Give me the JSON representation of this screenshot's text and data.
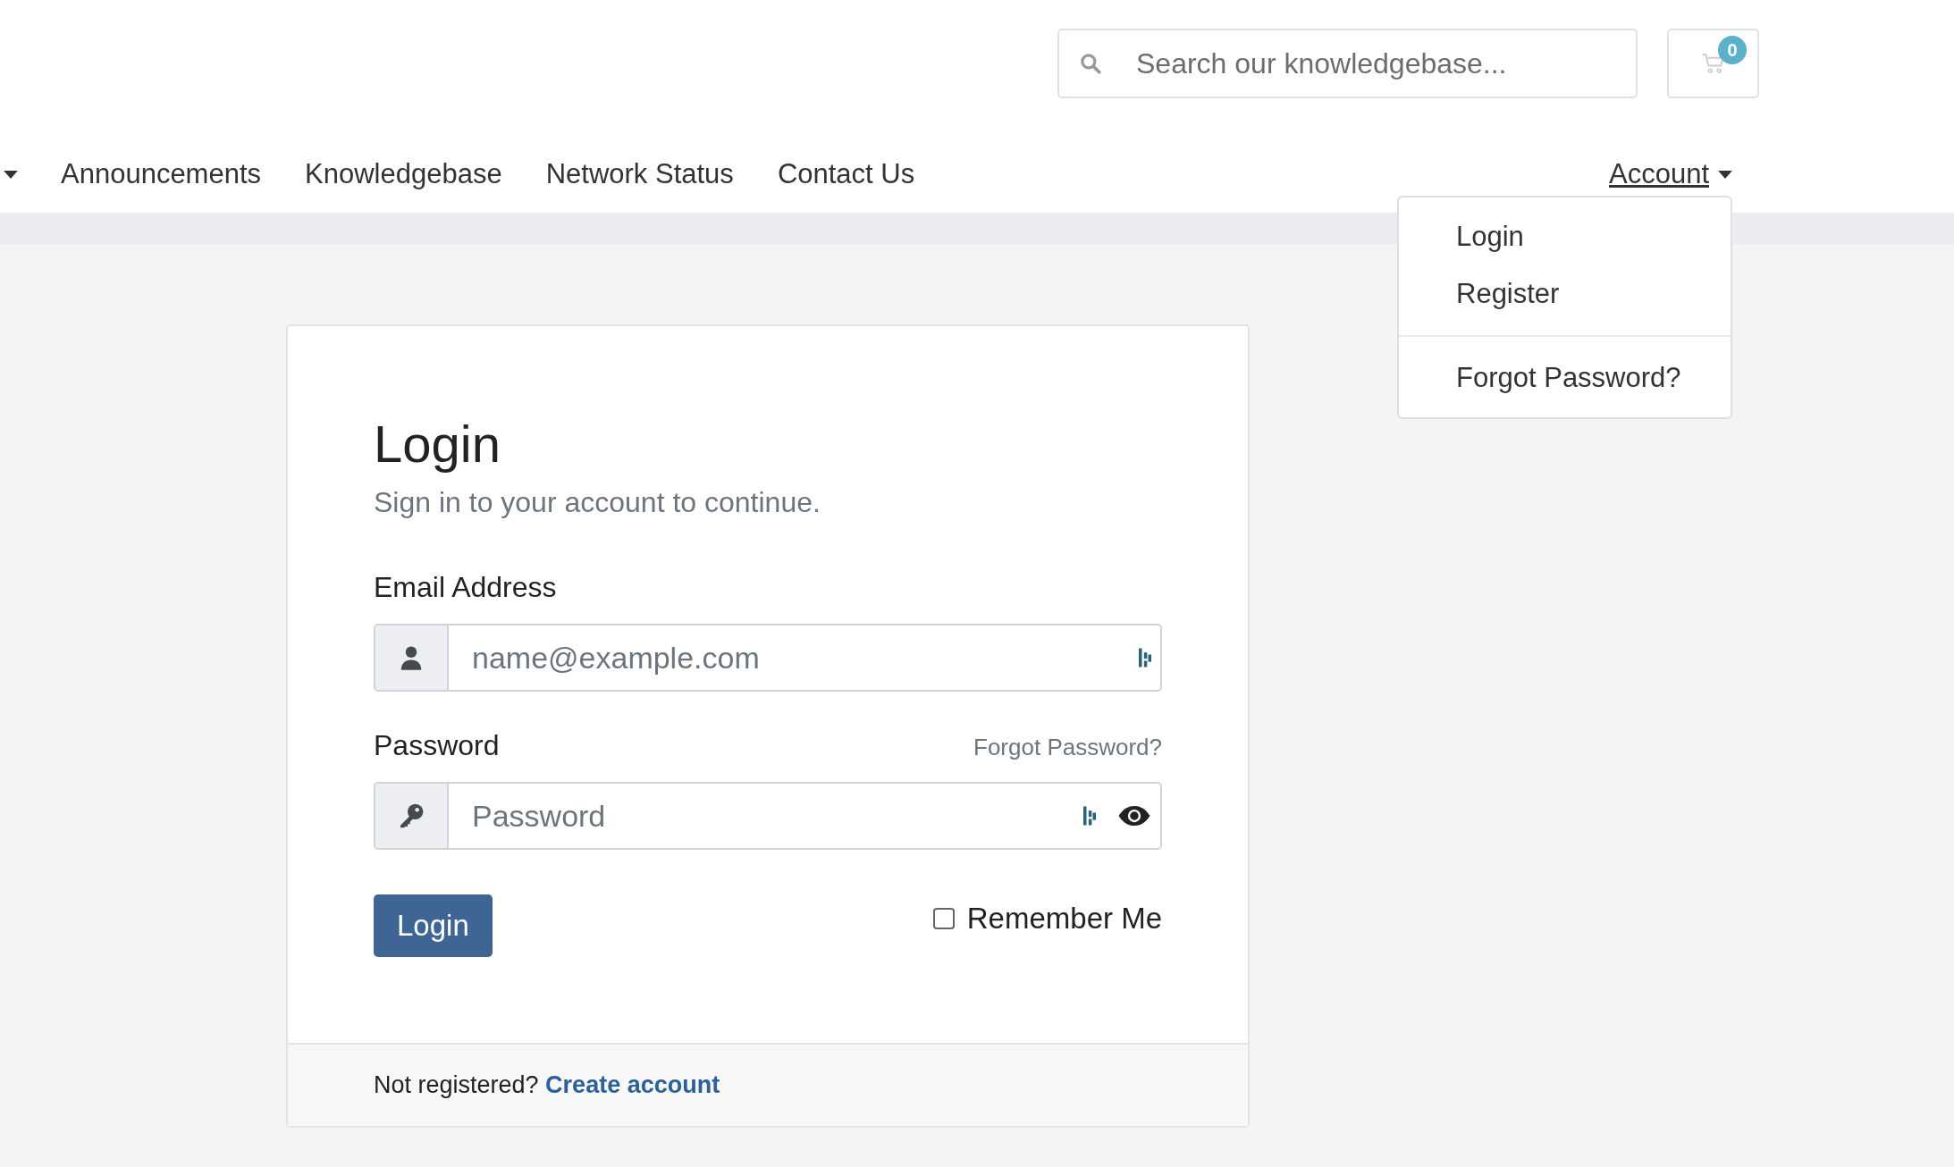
{
  "header": {
    "search": {
      "placeholder": "Search our knowledgebase..."
    },
    "cart": {
      "count": "0"
    }
  },
  "nav": {
    "items": [
      {
        "label": "Announcements"
      },
      {
        "label": "Knowledgebase"
      },
      {
        "label": "Network Status"
      },
      {
        "label": "Contact Us"
      }
    ],
    "account": {
      "label": "Account",
      "expanded": true,
      "groups": [
        [
          {
            "label": "Login"
          },
          {
            "label": "Register"
          }
        ],
        [
          {
            "label": "Forgot Password?"
          }
        ]
      ]
    }
  },
  "login": {
    "title": "Login",
    "subtitle": "Sign in to your account to continue.",
    "email": {
      "label": "Email Address",
      "placeholder": "name@example.com"
    },
    "password": {
      "label": "Password",
      "placeholder": "Password",
      "forgot_link": "Forgot Password?"
    },
    "submit": "Login",
    "remember": {
      "label": "Remember Me",
      "checked": false
    },
    "footer": {
      "text": "Not registered?",
      "link": "Create account"
    }
  }
}
